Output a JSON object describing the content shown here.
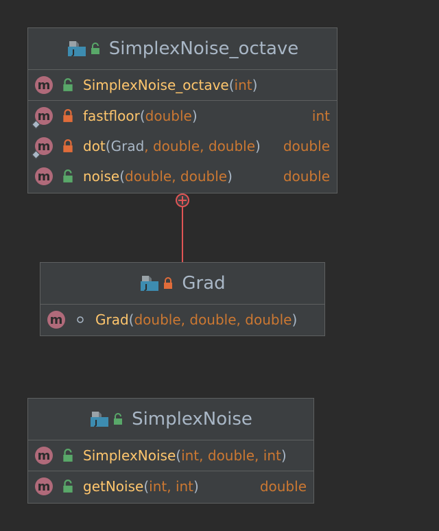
{
  "classes": [
    {
      "name": "SimplexNoise_octave",
      "visibility": "public",
      "constructors": [
        {
          "name": "SimplexNoise_octave",
          "params": [
            "int"
          ],
          "visibility": "public",
          "return": ""
        }
      ],
      "methods": [
        {
          "name": "fastfloor",
          "params": [
            "double"
          ],
          "visibility": "private",
          "static": true,
          "return": "int"
        },
        {
          "name": "dot",
          "params": [
            "Grad",
            "double",
            "double"
          ],
          "visibility": "private",
          "static": true,
          "return": "double"
        },
        {
          "name": "noise",
          "params": [
            "double",
            "double"
          ],
          "visibility": "public",
          "return": "double"
        }
      ]
    },
    {
      "name": "Grad",
      "visibility": "private",
      "constructors": [
        {
          "name": "Grad",
          "params": [
            "double",
            "double",
            "double"
          ],
          "visibility": "package",
          "return": ""
        }
      ],
      "methods": []
    },
    {
      "name": "SimplexNoise",
      "visibility": "public",
      "constructors": [
        {
          "name": "SimplexNoise",
          "params": [
            "int",
            "double",
            "int"
          ],
          "visibility": "public",
          "return": ""
        }
      ],
      "methods": [
        {
          "name": "getNoise",
          "params": [
            "int",
            "int"
          ],
          "visibility": "public",
          "return": "double"
        }
      ]
    }
  ],
  "method_badge": "m",
  "icons": {
    "class_icon": "java-class-file-icon",
    "public": "open-lock-icon",
    "private": "lock-icon",
    "package": "dot-icon",
    "static": "diamond-icon",
    "nested": "circle-plus-icon"
  },
  "colors": {
    "background": "#2b2b2b",
    "box": "#3c3f41",
    "border": "#5e6060",
    "class_name": "#a9b7c6",
    "method_name": "#ffc66d",
    "type": "#cc7832",
    "badge": "#b06a7a",
    "public": "#59a869",
    "private": "#e06c3a",
    "connector": "#e05555"
  }
}
